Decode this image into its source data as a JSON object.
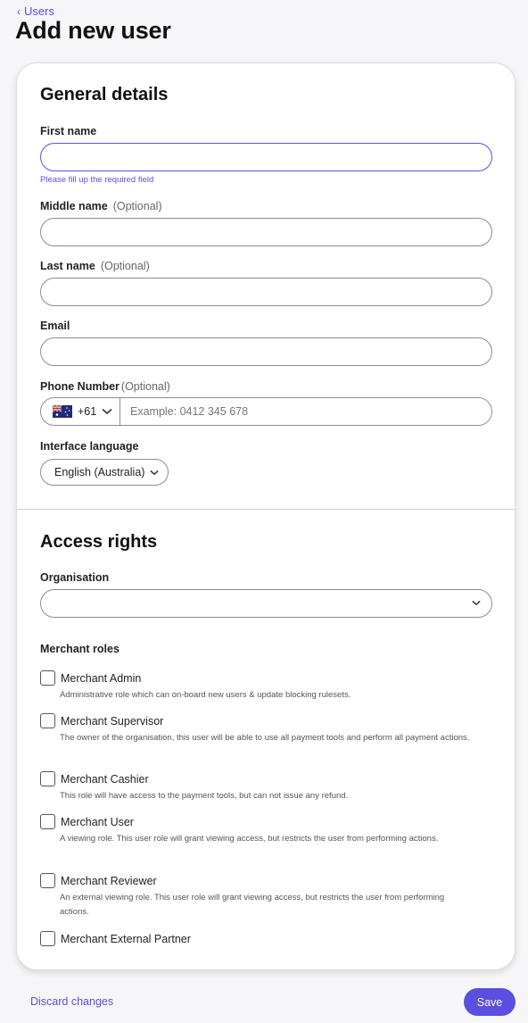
{
  "breadcrumb": {
    "label": "Users"
  },
  "page": {
    "title": "Add new user"
  },
  "general": {
    "title": "General details",
    "first_name": {
      "label": "First name",
      "value": "",
      "error": "Please fill up the required field"
    },
    "middle_name": {
      "label": "Middle name",
      "optional": "(Optional)",
      "value": ""
    },
    "last_name": {
      "label": "Last name",
      "optional": "(Optional)",
      "value": ""
    },
    "email": {
      "label": "Email",
      "value": ""
    },
    "phone": {
      "label": "Phone Number",
      "optional": "(Optional)",
      "country_code": "+61",
      "placeholder": "Example: 0412 345 678",
      "flag": "australia-flag"
    },
    "language": {
      "label": "Interface language",
      "value": "English (Australia)"
    }
  },
  "access": {
    "title": "Access rights",
    "organisation": {
      "label": "Organisation",
      "value": ""
    },
    "roles_label": "Merchant roles",
    "roles": [
      {
        "name": "Merchant Admin",
        "description": "Administrative role which can on-board new users & update blocking rulesets.",
        "checked": false
      },
      {
        "name": "Merchant Supervisor",
        "description": "The owner of the organisation, this user will be able to use all payment tools and perform all payment actions.",
        "checked": false
      },
      {
        "name": "Merchant Cashier",
        "description": "This role will have access to the payment tools, but can not issue any refund.",
        "checked": false
      },
      {
        "name": "Merchant User",
        "description": "A viewing role. This user role will grant viewing access, but restricts the user from performing actions.",
        "checked": false
      },
      {
        "name": "Merchant Reviewer",
        "description": "An external viewing role. This user role will grant viewing access, but restricts the user from performing actions.",
        "checked": false
      },
      {
        "name": "Merchant External Partner",
        "description": "",
        "checked": false
      }
    ]
  },
  "footer": {
    "discard_label": "Discard changes",
    "save_label": "Save"
  },
  "colors": {
    "accent": "#5b4fe0",
    "border": "#8c8c96",
    "background": "#f6f6f8"
  }
}
